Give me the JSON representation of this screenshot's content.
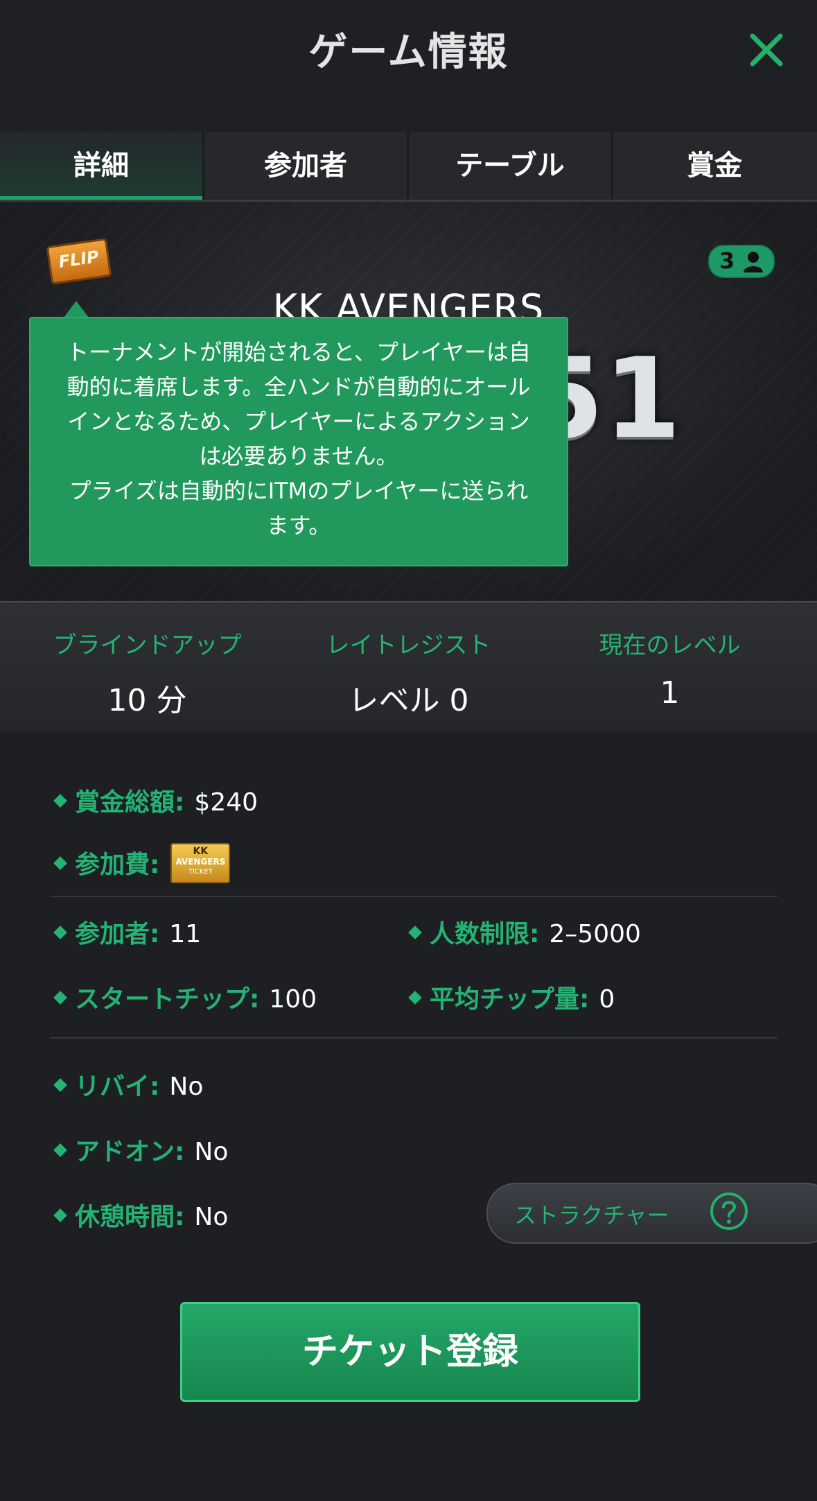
{
  "header": {
    "title": "ゲーム情報"
  },
  "tabs": [
    {
      "label": "詳細",
      "active": true
    },
    {
      "label": "参加者",
      "active": false
    },
    {
      "label": "テーブル",
      "active": false
    },
    {
      "label": "賞金",
      "active": false
    }
  ],
  "hero": {
    "badge": "FLIP",
    "player_count": "3",
    "game_name": "KK AVENGERS",
    "big_number": "51"
  },
  "tooltip": {
    "text": "トーナメントが開始されると、プレイヤーは自\n動的に着席します。全ハンドが自動的にオール\nインとなるため、プレイヤーによるアクション\nは必要ありません。\nプライズは自動的にITMのプレイヤーに送られ\nます。"
  },
  "stats": {
    "blind_up": {
      "label": "ブラインドアップ",
      "value": "10 分"
    },
    "late_reg": {
      "label": "レイトレジスト",
      "value": "レベル 0"
    },
    "current_level": {
      "label": "現在のレベル",
      "value": "1"
    }
  },
  "info": {
    "prize_pool": {
      "label": "賞金総額:",
      "value": "$240"
    },
    "buy_in": {
      "label": "参加費:",
      "ticket_line1": "KK",
      "ticket_line2": "AVENGERS",
      "ticket_line3": "TICKET"
    },
    "entrants": {
      "label": "参加者:",
      "value": "11"
    },
    "player_limit": {
      "label": "人数制限:",
      "value": "2–5000"
    },
    "start_chips": {
      "label": "スタートチップ:",
      "value": "100"
    },
    "avg_chips": {
      "label": "平均チップ量:",
      "value": "0"
    },
    "rebuy": {
      "label": "リバイ:",
      "value": "No"
    },
    "addon": {
      "label": "アドオン:",
      "value": "No"
    },
    "break": {
      "label": "休憩時間:",
      "value": "No"
    }
  },
  "structure_button": {
    "label": "ストラクチャー"
  },
  "register_button": {
    "label": "チケット登録"
  },
  "colors": {
    "accent": "#25b374",
    "tooltip_bg": "#21995d",
    "button_bg": "#1e9a5e"
  }
}
